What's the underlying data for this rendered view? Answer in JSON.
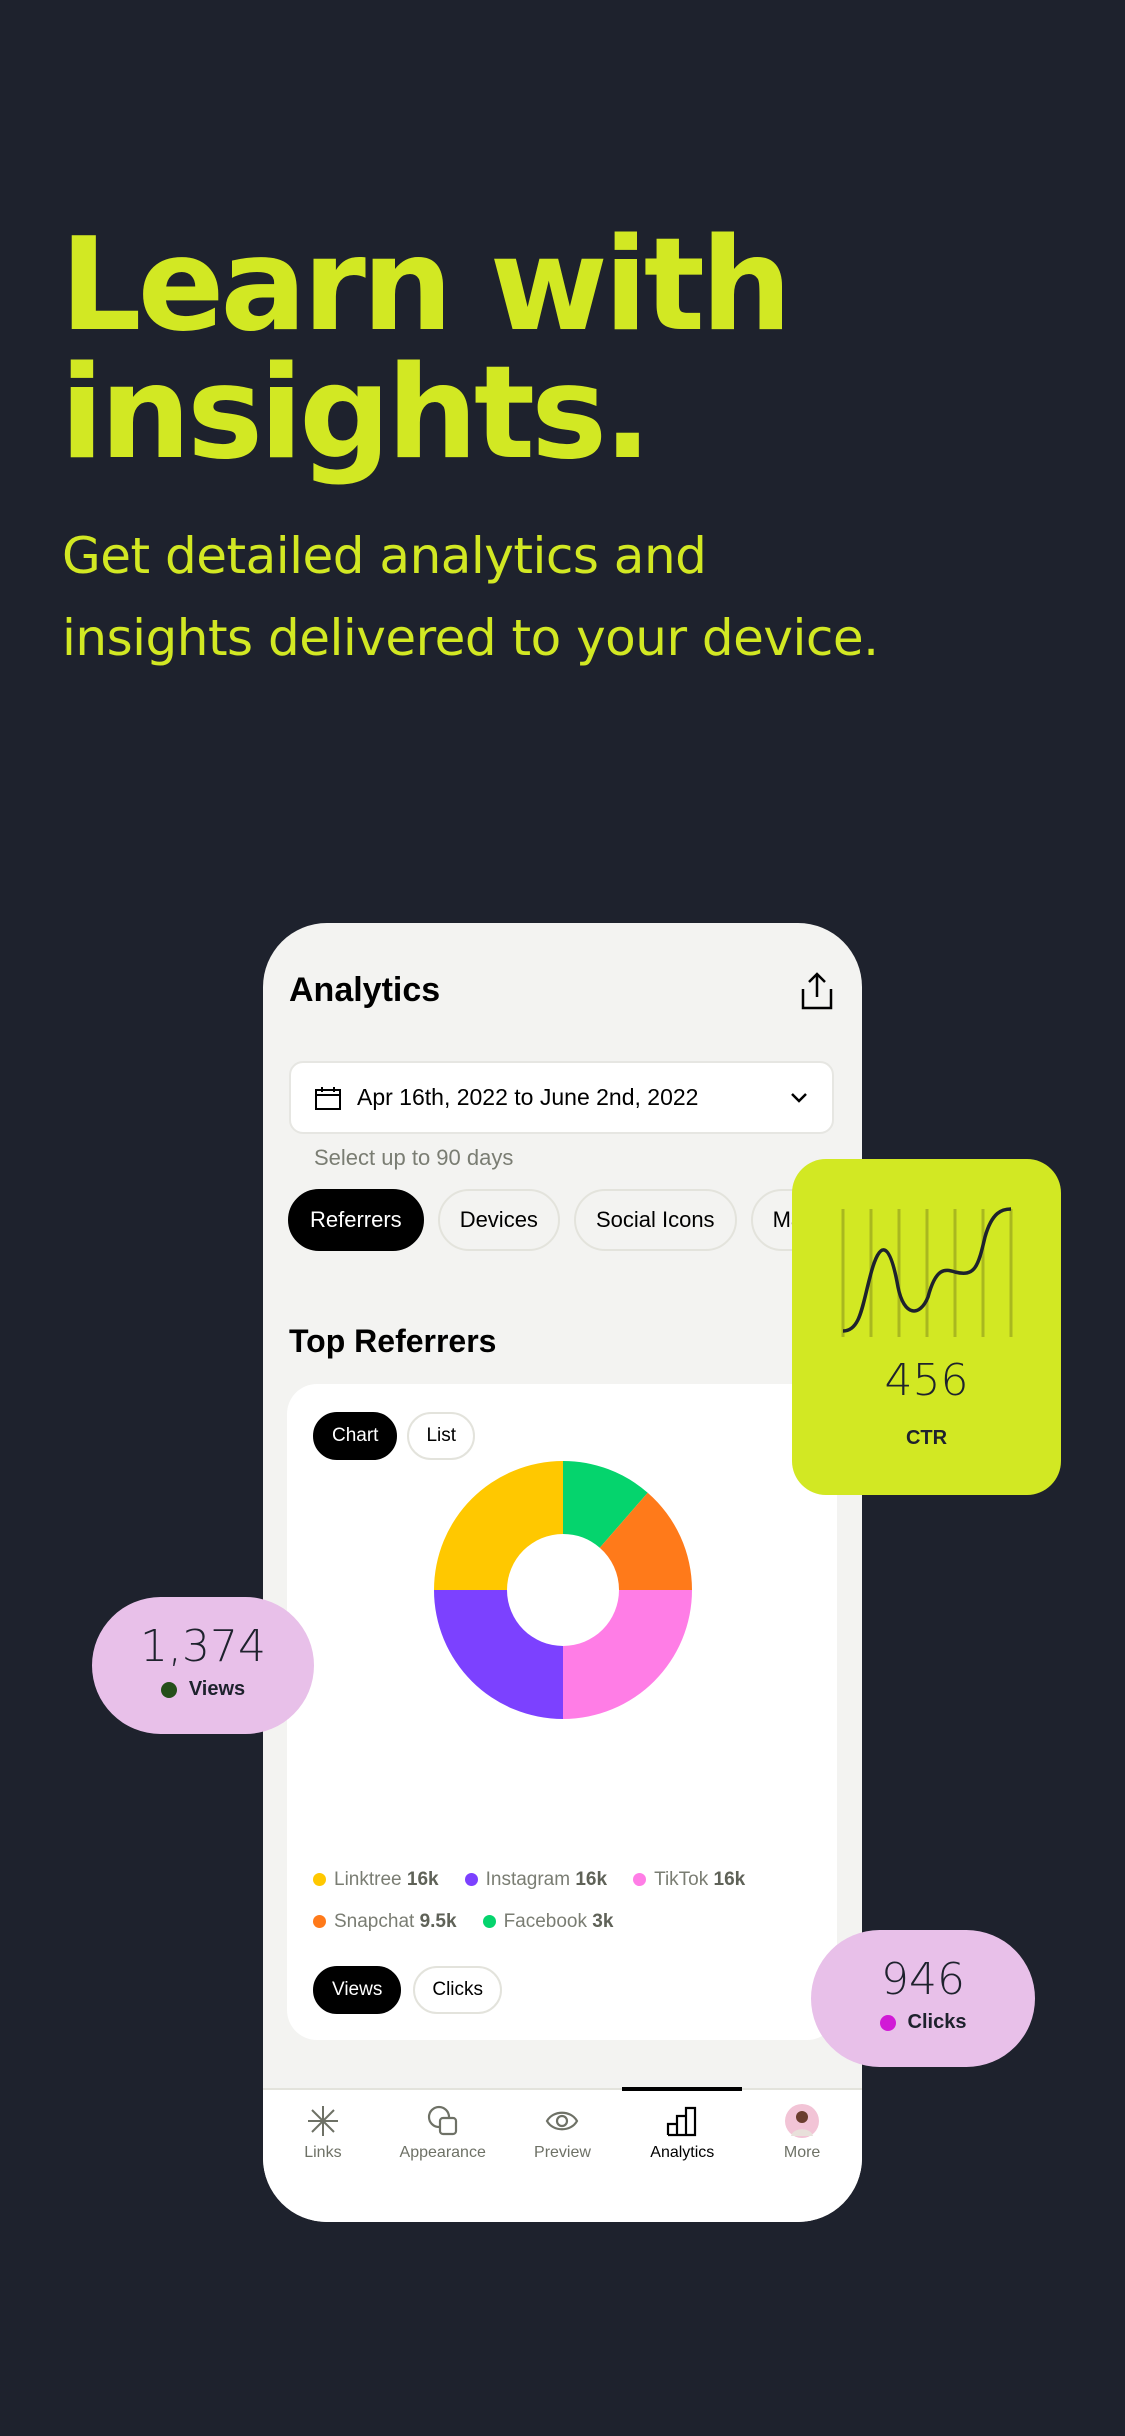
{
  "headline": {
    "line1": "Learn with",
    "line2": "insights.",
    "subtitle_line1": "Get detailed analytics and",
    "subtitle_line2": "insights delivered to your device.",
    "color": "#d2e823"
  },
  "app": {
    "title": "Analytics",
    "share_icon": "share-icon",
    "date_range": "Apr 16th, 2022 to June 2nd, 2022",
    "date_hint": "Select up to 90 days",
    "filter_tabs": [
      {
        "label": "Referrers",
        "active": true
      },
      {
        "label": "Devices"
      },
      {
        "label": "Social Icons"
      },
      {
        "label": "Mai"
      }
    ],
    "section_title": "Top Referrers",
    "view_toggle": [
      {
        "label": "Chart",
        "active": true
      },
      {
        "label": "List"
      }
    ],
    "metric_toggle": [
      {
        "label": "Views",
        "active": true
      },
      {
        "label": "Clicks"
      }
    ],
    "nav": [
      {
        "label": "Links",
        "icon": "asterisk-icon"
      },
      {
        "label": "Appearance",
        "icon": "shapes-icon"
      },
      {
        "label": "Preview",
        "icon": "eye-icon"
      },
      {
        "label": "Analytics",
        "icon": "bar-chart-icon",
        "active": true
      },
      {
        "label": "More",
        "icon": "avatar"
      }
    ]
  },
  "chart_data": {
    "type": "pie",
    "donut": true,
    "slices": [
      {
        "name": "Facebook",
        "label": "3k",
        "color": "#05d46d",
        "share_pct": 11.4
      },
      {
        "name": "Snapchat",
        "label": "9.5k",
        "color": "#ff7a1a",
        "share_pct": 13.6
      },
      {
        "name": "TikTok",
        "label": "16k",
        "color": "#ff7de6",
        "share_pct": 25
      },
      {
        "name": "Instagram",
        "label": "16k",
        "color": "#7c41ff",
        "share_pct": 25
      },
      {
        "name": "Linktree",
        "label": "16k",
        "color": "#ffc800",
        "share_pct": 25
      }
    ],
    "legend_order": [
      "Linktree",
      "Instagram",
      "TikTok",
      "Snapchat",
      "Facebook"
    ]
  },
  "cards": {
    "ctr": {
      "value": "456",
      "label": "CTR"
    },
    "views": {
      "value": "1,374",
      "label": "Views",
      "dot_color": "#254f1a"
    },
    "clicks": {
      "value": "946",
      "label": "Clicks",
      "dot_color": "#d11ad6"
    }
  }
}
